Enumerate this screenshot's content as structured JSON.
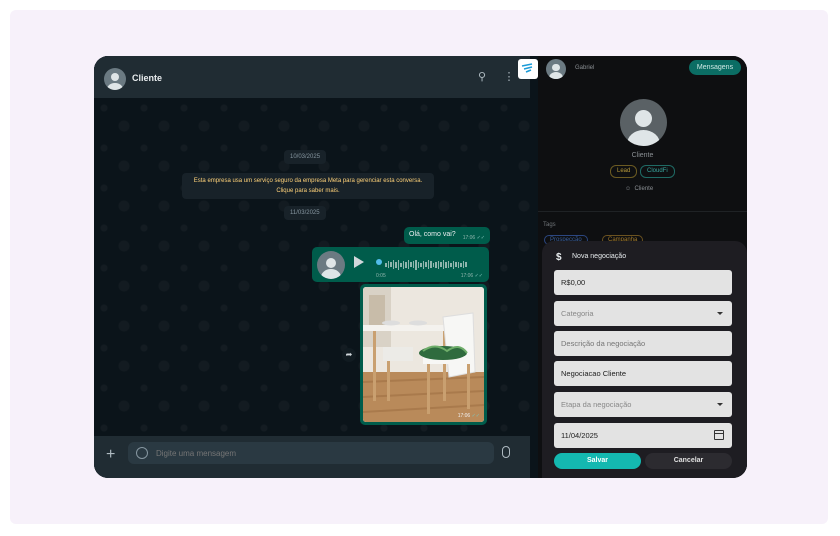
{
  "chat": {
    "contact_name": "Cliente",
    "dates": [
      "10/03/2025",
      "11/03/2025"
    ],
    "system_message": "Esta empresa usa um serviço seguro da empresa Meta para gerenciar esta conversa. Clique para saber mais.",
    "messages": {
      "text": {
        "body": "Olá, como vai?",
        "time": "17:06"
      },
      "audio": {
        "duration": "0:05",
        "time": "17:06"
      },
      "image": {
        "time": "17:06"
      }
    },
    "input_placeholder": "Digite uma mensagem"
  },
  "crm": {
    "header_name": "Gabriel",
    "messages_button": "Mensagens",
    "profile_name": "Cliente",
    "badges": [
      "Lead",
      "CloudFi"
    ],
    "contact_type": "Cliente",
    "tags_label": "Tags",
    "tag_chips": [
      "Prospecção",
      "Campanha"
    ]
  },
  "deal_form": {
    "title": "Nova negociação",
    "value": "R$0,00",
    "category_placeholder": "Categoria",
    "description_placeholder": "Descrição da negociação",
    "name": "Negociacao Cliente",
    "stage_placeholder": "Etapa da negociação",
    "date": "11/04/2025",
    "save_label": "Salvar",
    "cancel_label": "Cancelar"
  },
  "colors": {
    "accent": "#14b8b0",
    "bubble": "#005c4b",
    "chat_bg": "#0b141a",
    "header_bg": "#202c33"
  }
}
